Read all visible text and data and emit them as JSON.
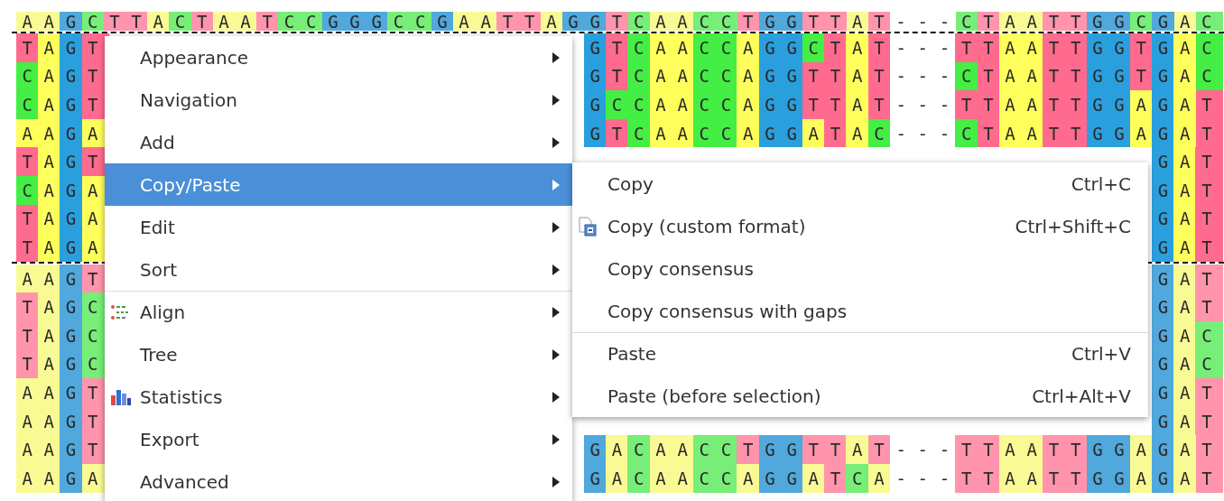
{
  "alignment": {
    "groups": [
      {
        "selected": false,
        "rows": [
          {
            "left": "AAGCTTACTAATCCGGGCCGAATTAGGTCAACCTGGTTAT---CTAATTGGCGAC"
          }
        ]
      },
      {
        "selected": true,
        "rows": [
          {
            "left": "TAGT",
            "right": "GTCAACCAGGCTAT---TTAATTGGTGAC"
          },
          {
            "left": "CAGT",
            "right": "GTCAACCAGGTTAT---CTAATTGGTGAC"
          },
          {
            "left": "CAGT",
            "right": "GCCAACCAGGTTAT---TTAATTGGAGAT"
          },
          {
            "left": "AAGA",
            "right": "GTCAACCAGGATAC---CTAATTGGAGAT"
          },
          {
            "left": "TAGT",
            "right": "GAT"
          },
          {
            "left": "CAGA",
            "right": "GAT"
          },
          {
            "left": "TAGA",
            "right": "GAT"
          },
          {
            "left": "TAGA",
            "right": "GAT"
          }
        ]
      },
      {
        "selected": false,
        "rows": [
          {
            "left": "AAGT",
            "right": "GAT"
          },
          {
            "left": "TAGC",
            "right": "GAT"
          },
          {
            "left": "TAGC",
            "right": "GAC"
          },
          {
            "left": "TAGC",
            "right": "GAC"
          },
          {
            "left": "AAGT",
            "right": "GAT"
          },
          {
            "left": "AAGT",
            "right": "GAT"
          },
          {
            "left": "AAGT",
            "right": "GACAACCTGGTTAT---TTAATTGGAGAT"
          },
          {
            "left": "AAGA",
            "right": "GACAACCAGGATCA---TTAATTGGAGAT"
          }
        ]
      }
    ]
  },
  "context_menu": {
    "items": [
      {
        "kind": "plain",
        "label": "Appearance",
        "selected": false,
        "separator_before": false
      },
      {
        "kind": "plain",
        "label": "Navigation",
        "selected": false,
        "separator_before": false
      },
      {
        "kind": "plain",
        "label": "Add",
        "selected": false,
        "separator_before": false
      },
      {
        "kind": "plain",
        "label": "Copy/Paste",
        "selected": true,
        "separator_before": false
      },
      {
        "kind": "plain",
        "label": "Edit",
        "selected": false,
        "separator_before": false
      },
      {
        "kind": "plain",
        "label": "Sort",
        "selected": false,
        "separator_before": false
      },
      {
        "kind": "align",
        "label": "Align",
        "selected": false,
        "separator_before": true
      },
      {
        "kind": "plain",
        "label": "Tree",
        "selected": false,
        "separator_before": false
      },
      {
        "kind": "statistics",
        "label": "Statistics",
        "selected": false,
        "separator_before": false
      },
      {
        "kind": "plain",
        "label": "Export",
        "selected": false,
        "separator_before": false
      },
      {
        "kind": "plain",
        "label": "Advanced",
        "selected": false,
        "separator_before": false
      }
    ]
  },
  "submenu": {
    "items": [
      {
        "kind": "plain",
        "label": "Copy",
        "shortcut": "Ctrl+C",
        "selected": false,
        "separator_before": false
      },
      {
        "kind": "format",
        "label": "Copy (custom format)",
        "shortcut": "Ctrl+Shift+C",
        "selected": false,
        "separator_before": false
      },
      {
        "kind": "plain",
        "label": "Copy consensus",
        "selected": false,
        "separator_before": false
      },
      {
        "kind": "plain",
        "label": "Copy consensus with gaps",
        "selected": false,
        "separator_before": false
      },
      {
        "kind": "plain",
        "label": "Paste",
        "shortcut": "Ctrl+V",
        "selected": false,
        "separator_before": true
      },
      {
        "kind": "plain",
        "label": "Paste (before selection)",
        "shortcut": "Ctrl+Alt+V",
        "selected": false,
        "separator_before": false
      }
    ]
  }
}
